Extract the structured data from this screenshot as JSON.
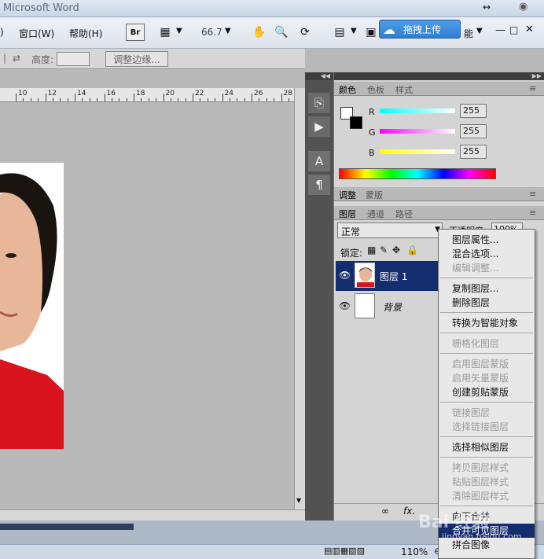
{
  "app": {
    "title": "Microsoft Word"
  },
  "menu": {
    "items": [
      "窗口(W)",
      "帮助(H)"
    ],
    "first_fragment": ")"
  },
  "toolbar": {
    "zoom": "66.7",
    "br_label": "Br"
  },
  "upload": {
    "label": "拖拽上传"
  },
  "options": {
    "height_label": "高度:",
    "refine_button": "调整边缘..."
  },
  "ruler": {
    "labels": [
      "10",
      "12",
      "14",
      "16",
      "18",
      "20",
      "22",
      "24",
      "26",
      "28"
    ]
  },
  "color_panel": {
    "tabs": [
      "颜色",
      "色板",
      "样式"
    ],
    "channels": [
      {
        "name": "R",
        "value": "255"
      },
      {
        "name": "G",
        "value": "255"
      },
      {
        "name": "B",
        "value": "255"
      }
    ]
  },
  "adjust_panel": {
    "tabs": [
      "调整",
      "蒙版"
    ]
  },
  "layers_panel": {
    "tabs": [
      "图层",
      "通道",
      "路径"
    ],
    "blend_mode": "正常",
    "opacity_label": "不透明度:",
    "opacity_value": "100%",
    "lock_label": "锁定:",
    "layers": [
      {
        "name": "图层 1",
        "selected": true
      },
      {
        "name": "背景",
        "selected": false
      }
    ],
    "fx_label": "fx."
  },
  "context_menu": {
    "groups": [
      [
        {
          "label": "图层属性...",
          "enabled": true
        },
        {
          "label": "混合选项...",
          "enabled": true
        },
        {
          "label": "编辑调整...",
          "enabled": false
        }
      ],
      [
        {
          "label": "复制图层...",
          "enabled": true
        },
        {
          "label": "删除图层",
          "enabled": true
        }
      ],
      [
        {
          "label": "转换为智能对象",
          "enabled": true
        }
      ],
      [
        {
          "label": "栅格化图层",
          "enabled": false
        }
      ],
      [
        {
          "label": "启用图层蒙版",
          "enabled": false
        },
        {
          "label": "启用矢量蒙版",
          "enabled": false
        },
        {
          "label": "创建剪贴蒙版",
          "enabled": true
        }
      ],
      [
        {
          "label": "链接图层",
          "enabled": false
        },
        {
          "label": "选择链接图层",
          "enabled": false
        }
      ],
      [
        {
          "label": "选择相似图层",
          "enabled": true
        }
      ],
      [
        {
          "label": "拷贝图层样式",
          "enabled": false
        },
        {
          "label": "粘贴图层样式",
          "enabled": false
        },
        {
          "label": "清除图层样式",
          "enabled": false
        }
      ],
      [
        {
          "label": "向下合并",
          "enabled": true
        },
        {
          "label": "合并可见图层",
          "enabled": true,
          "highlighted": true
        },
        {
          "label": "拼合图像",
          "enabled": true
        }
      ]
    ]
  },
  "status": {
    "zoom": "110%"
  },
  "watermark": {
    "text": "Bai 经验",
    "url": "jingyan.baidu.com"
  }
}
